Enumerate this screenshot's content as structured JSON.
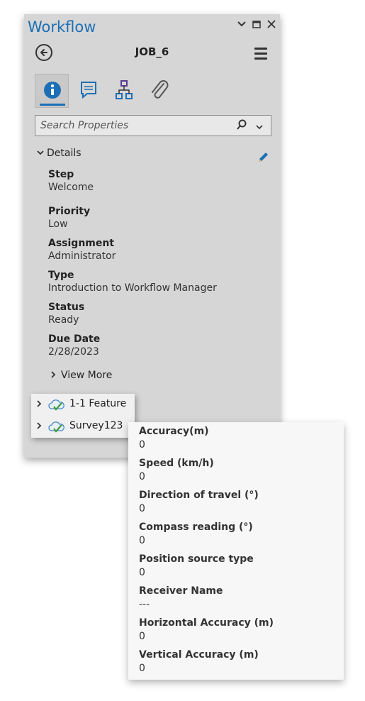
{
  "window": {
    "title": "Workflow",
    "controls": [
      "chevron-down",
      "restore",
      "close"
    ]
  },
  "header": {
    "job_title": "JOB_6"
  },
  "tabs": [
    {
      "name": "info",
      "icon": "info-icon",
      "active": true
    },
    {
      "name": "comments",
      "icon": "comment-icon",
      "active": false
    },
    {
      "name": "hierarchy",
      "icon": "hierarchy-icon",
      "active": false
    },
    {
      "name": "attachments",
      "icon": "paperclip-icon",
      "active": false
    }
  ],
  "search": {
    "placeholder": "Search Properties"
  },
  "details": {
    "header": "Details",
    "fields": [
      {
        "label": "Step",
        "value": "Welcome"
      },
      {
        "label": "Priority",
        "value": "Low"
      },
      {
        "label": "Assignment",
        "value": "Administrator"
      },
      {
        "label": "Type",
        "value": "Introduction to Workflow Manager"
      },
      {
        "label": "Status",
        "value": "Ready"
      },
      {
        "label": "Due Date",
        "value": "2/28/2023"
      }
    ],
    "view_more": "View More"
  },
  "layers": [
    {
      "name": "1-1 Feature"
    },
    {
      "name": "Survey123"
    }
  ],
  "popup": {
    "fields": [
      {
        "label": "Accuracy(m)",
        "value": "0"
      },
      {
        "label": "Speed (km/h)",
        "value": "0"
      },
      {
        "label": "Direction of travel (°)",
        "value": "0"
      },
      {
        "label": "Compass reading (°)",
        "value": "0"
      },
      {
        "label": "Position source type",
        "value": "0"
      },
      {
        "label": "Receiver Name",
        "value": "---"
      },
      {
        "label": "Horizontal Accuracy (m)",
        "value": "0"
      },
      {
        "label": "Vertical Accuracy (m)",
        "value": "0"
      }
    ]
  },
  "colors": {
    "accent": "#1c6fb5",
    "panel_bg": "#d6d6d6",
    "popup_bg": "#f6f7f6",
    "check_green": "#3a9a3a"
  }
}
